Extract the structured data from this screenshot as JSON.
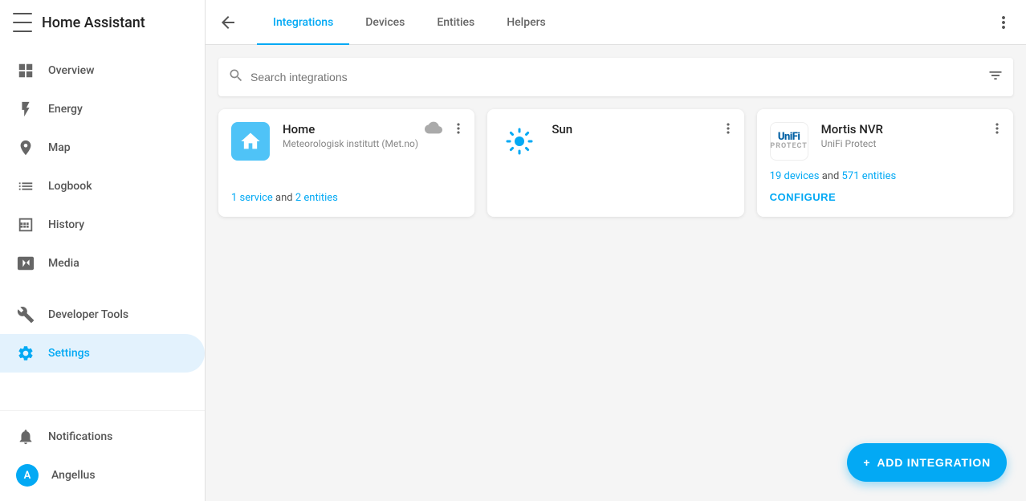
{
  "app": {
    "title": "Home Assistant"
  },
  "sidebar": {
    "menu_label": "Menu",
    "items": [
      {
        "id": "overview",
        "label": "Overview",
        "icon": "grid"
      },
      {
        "id": "energy",
        "label": "Energy",
        "icon": "bolt"
      },
      {
        "id": "map",
        "label": "Map",
        "icon": "person-pin"
      },
      {
        "id": "logbook",
        "label": "Logbook",
        "icon": "list"
      },
      {
        "id": "history",
        "label": "History",
        "icon": "bar-chart"
      },
      {
        "id": "media",
        "label": "Media",
        "icon": "play-circle"
      },
      {
        "id": "developer-tools",
        "label": "Developer Tools",
        "icon": "wrench"
      },
      {
        "id": "settings",
        "label": "Settings",
        "icon": "gear",
        "active": true
      }
    ],
    "bottom": [
      {
        "id": "notifications",
        "label": "Notifications",
        "icon": "bell"
      },
      {
        "id": "user",
        "label": "Angellus",
        "icon": "avatar",
        "initials": "A"
      }
    ]
  },
  "topbar": {
    "tabs": [
      {
        "id": "integrations",
        "label": "Integrations",
        "active": true
      },
      {
        "id": "devices",
        "label": "Devices"
      },
      {
        "id": "entities",
        "label": "Entities"
      },
      {
        "id": "helpers",
        "label": "Helpers"
      }
    ]
  },
  "search": {
    "placeholder": "Search integrations"
  },
  "integrations": [
    {
      "id": "home",
      "title": "Home",
      "subtitle": "Meteorologisk institutt (Met.no)",
      "logo_type": "home",
      "logo_letter": "🏠",
      "has_cloud": true,
      "links_text": "1 service",
      "links_mid": " and ",
      "links_text2": "2 entities",
      "configure": false
    },
    {
      "id": "sun",
      "title": "Sun",
      "subtitle": "",
      "logo_type": "sun",
      "has_cloud": false,
      "links_text": "",
      "links_mid": "",
      "links_text2": "",
      "configure": false
    },
    {
      "id": "mortis-nvr",
      "title": "Mortis NVR",
      "subtitle": "UniFi Protect",
      "logo_type": "unifi",
      "has_cloud": false,
      "links_text": "19 devices",
      "links_mid": " and ",
      "links_text2": "571 entities",
      "configure": true,
      "configure_label": "CONFIGURE"
    }
  ],
  "fab": {
    "label": "ADD INTEGRATION",
    "plus": "+"
  }
}
